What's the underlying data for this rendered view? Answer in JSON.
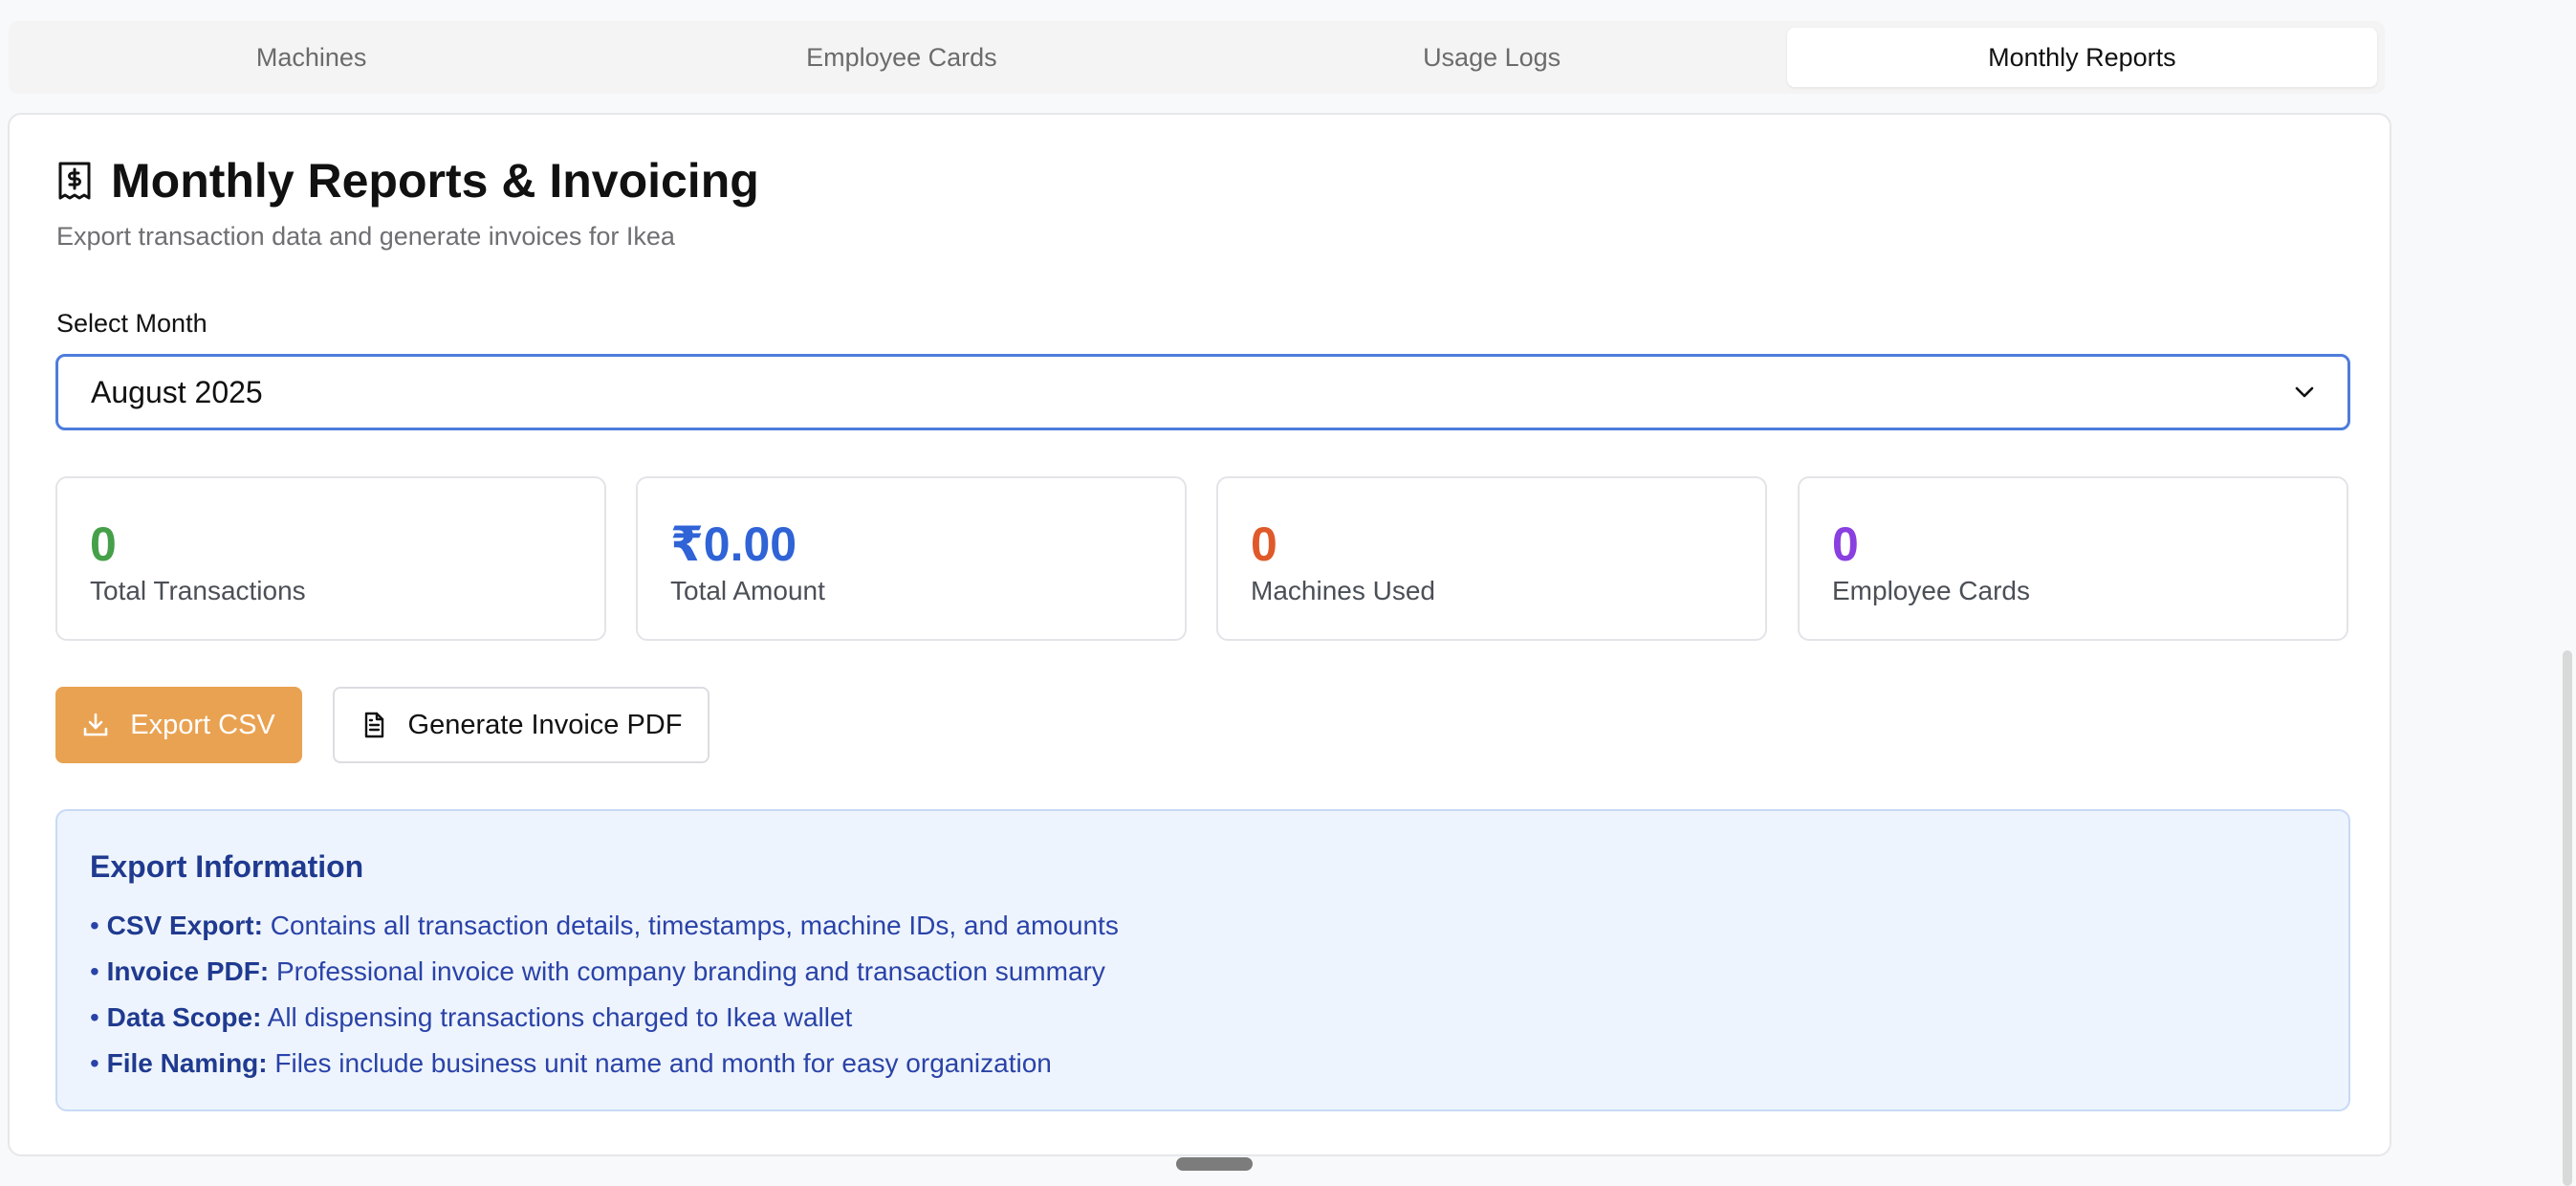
{
  "tabs": [
    {
      "label": "Machines",
      "active": false
    },
    {
      "label": "Employee Cards",
      "active": false
    },
    {
      "label": "Usage Logs",
      "active": false
    },
    {
      "label": "Monthly Reports",
      "active": true
    }
  ],
  "report": {
    "title_icon": "receipt-icon",
    "title": "Monthly Reports & Invoicing",
    "subtitle": "Export transaction data and generate invoices for Ikea"
  },
  "month_select": {
    "label": "Select Month",
    "selected": "August 2025"
  },
  "stats": [
    {
      "value": "0",
      "label": "Total Transactions",
      "color": "#45a049"
    },
    {
      "value": "₹0.00",
      "label": "Total Amount",
      "color": "#2f63d6"
    },
    {
      "value": "0",
      "label": "Machines Used",
      "color": "#e0592a"
    },
    {
      "value": "0",
      "label": "Employee Cards",
      "color": "#8a3fe0"
    }
  ],
  "actions": {
    "export_csv": {
      "label": "Export CSV",
      "icon": "download-icon",
      "color": "#e9a252"
    },
    "generate_pdf": {
      "label": "Generate Invoice PDF",
      "icon": "document-icon"
    }
  },
  "export_info": {
    "title": "Export Information",
    "bullet": "•",
    "items": [
      {
        "term": "CSV Export:",
        "text": "Contains all transaction details, timestamps, machine IDs, and amounts"
      },
      {
        "term": "Invoice PDF:",
        "text": "Professional invoice with company branding and transaction summary"
      },
      {
        "term": "Data Scope:",
        "text": "All dispensing transactions charged to Ikea wallet"
      },
      {
        "term": "File Naming:",
        "text": "Files include business unit name and month for easy organization"
      }
    ]
  }
}
